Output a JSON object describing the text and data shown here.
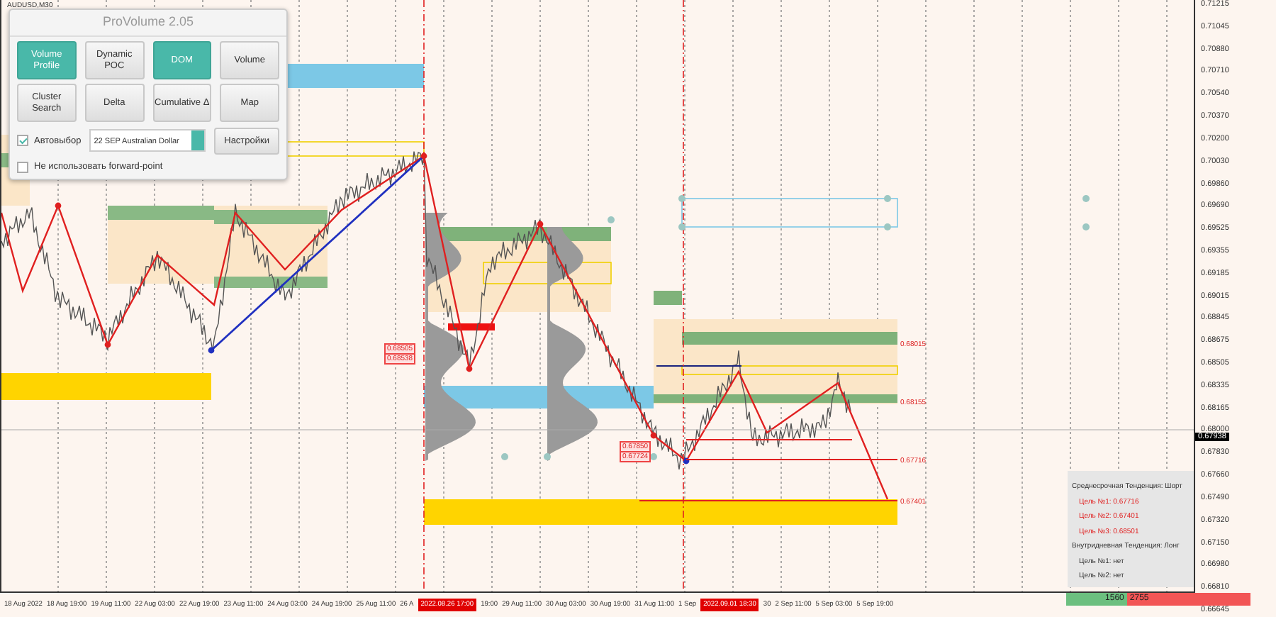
{
  "symbol": "AUDUSD,M30",
  "panel": {
    "title": "ProVolume 2.05",
    "buttons": [
      {
        "label": "Volume Profile",
        "on": true
      },
      {
        "label": "Dynamic POC",
        "on": false
      },
      {
        "label": "DOM",
        "on": true
      },
      {
        "label": "Volume",
        "on": false
      },
      {
        "label": "Cluster Search",
        "on": false
      },
      {
        "label": "Delta",
        "on": false
      },
      {
        "label": "Cumulative Δ",
        "on": false
      },
      {
        "label": "Map",
        "on": false
      }
    ],
    "auto_select": {
      "label": "Автовыбор",
      "checked": true
    },
    "instrument": {
      "value": "22 SEP Australian Dollar"
    },
    "settings_button": "Настройки",
    "forward_point": {
      "label": "Не использовать forward-point",
      "checked": false
    }
  },
  "price_axis": {
    "labels": [
      "0.71215",
      "0.71045",
      "0.70880",
      "0.70710",
      "0.70540",
      "0.70370",
      "0.70200",
      "0.70030",
      "0.69860",
      "0.69690",
      "0.69525",
      "0.69355",
      "0.69185",
      "0.69015",
      "0.68845",
      "0.68675",
      "0.68505",
      "0.68335",
      "0.68165",
      "0.68000",
      "0.67830",
      "0.67660",
      "0.67490",
      "0.67320",
      "0.67150",
      "0.66980",
      "0.66810",
      "0.66645"
    ],
    "current_price": "0.67938"
  },
  "chart_labels": [
    {
      "text": "0.68505",
      "kind": "box"
    },
    {
      "text": "0.68538",
      "kind": "box"
    },
    {
      "text": "0.67850",
      "kind": "box"
    },
    {
      "text": "0.67724",
      "kind": "box"
    },
    {
      "text": "0.68015",
      "kind": "plain"
    },
    {
      "text": "0.68155",
      "kind": "plain"
    },
    {
      "text": "0.67716",
      "kind": "plain"
    },
    {
      "text": "0.67401",
      "kind": "plain"
    }
  ],
  "time_axis": [
    {
      "text": "18 Aug 2022",
      "kind": "plain"
    },
    {
      "text": "18 Aug 19:00",
      "kind": "plain"
    },
    {
      "text": "19 Aug 11:00",
      "kind": "plain"
    },
    {
      "text": "22 Aug 03:00",
      "kind": "plain"
    },
    {
      "text": "22 Aug 19:00",
      "kind": "plain"
    },
    {
      "text": "23 Aug 11:00",
      "kind": "plain"
    },
    {
      "text": "24 Aug 03:00",
      "kind": "plain"
    },
    {
      "text": "24 Aug 19:00",
      "kind": "plain"
    },
    {
      "text": "25 Aug 11:00",
      "kind": "plain"
    },
    {
      "text": "26 A",
      "kind": "plain"
    },
    {
      "text": "2022.08.26 17:00",
      "kind": "cursor"
    },
    {
      "text": "19:00",
      "kind": "plain"
    },
    {
      "text": "29 Aug 11:00",
      "kind": "plain"
    },
    {
      "text": "30 Aug 03:00",
      "kind": "plain"
    },
    {
      "text": "30 Aug 19:00",
      "kind": "plain"
    },
    {
      "text": "31 Aug 11:00",
      "kind": "plain"
    },
    {
      "text": "1 Sep",
      "kind": "plain"
    },
    {
      "text": "2022.09.01 18:30",
      "kind": "cursor"
    },
    {
      "text": "30",
      "kind": "plain"
    },
    {
      "text": "2 Sep 11:00",
      "kind": "plain"
    },
    {
      "text": "5 Sep 03:00",
      "kind": "plain"
    },
    {
      "text": "5 Sep 19:00",
      "kind": "plain"
    }
  ],
  "info": [
    {
      "text": "Среднесрочная Тенденция: Шорт",
      "kind": "heading"
    },
    {
      "text": "Цель №1: 0.67716",
      "kind": "target"
    },
    {
      "text": "Цель №2: 0.67401",
      "kind": "target"
    },
    {
      "text": "Цель №3: 0.68501",
      "kind": "target"
    },
    {
      "text": "Внутридневная Тенденция: Лонг",
      "kind": "heading"
    },
    {
      "text": "Цель №1: нет",
      "kind": "none"
    },
    {
      "text": "Цель №2: нет",
      "kind": "none"
    }
  ],
  "volume_balance": {
    "buy": "1560",
    "sell": "2755",
    "level": 0.33
  }
}
